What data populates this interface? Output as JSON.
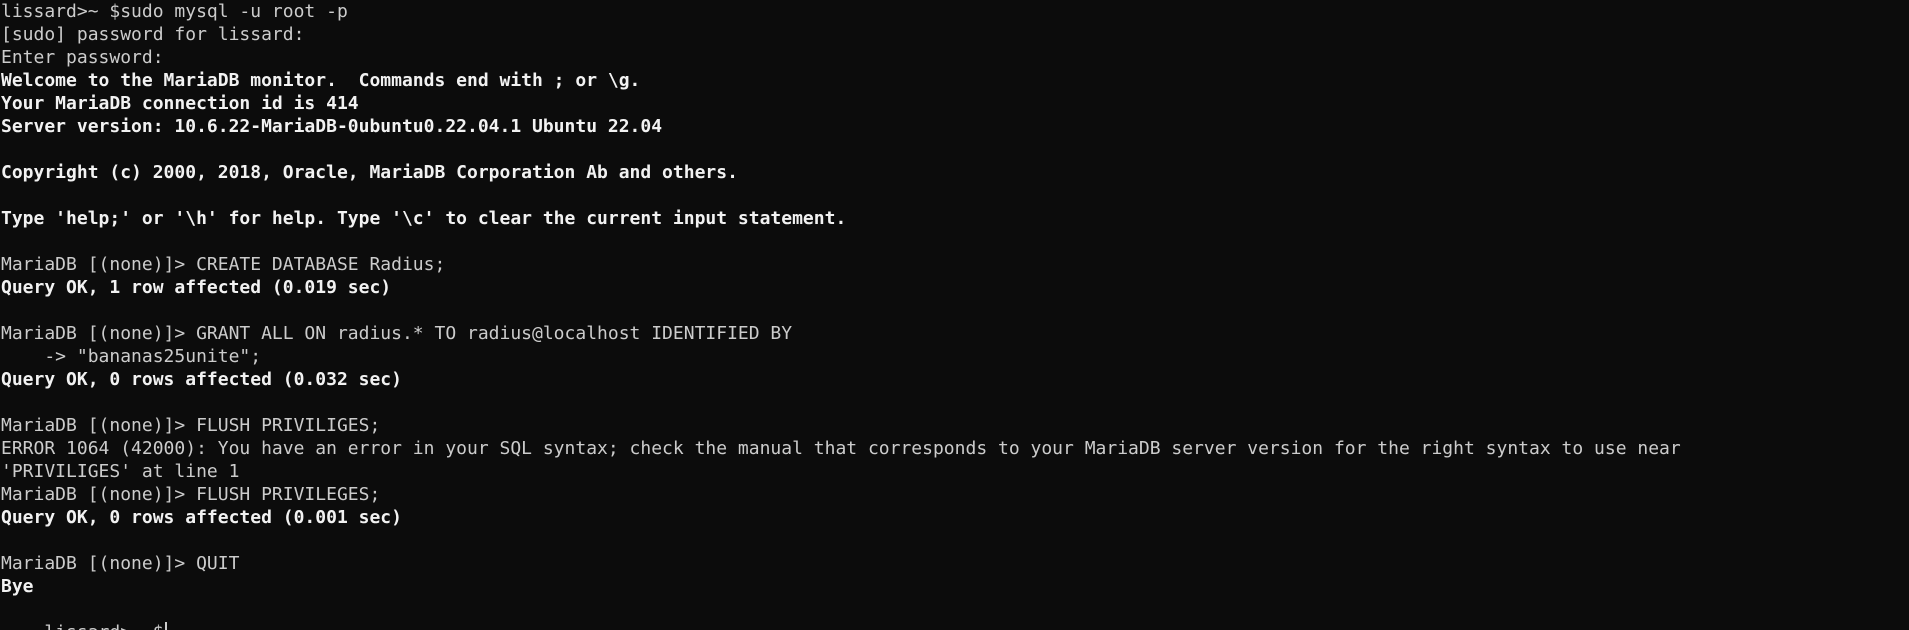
{
  "terminal": {
    "lines": [
      {
        "text": "lissard>~ $sudo mysql -u root -p",
        "style": "normal"
      },
      {
        "text": "[sudo] password for lissard:",
        "style": "normal"
      },
      {
        "text": "Enter password:",
        "style": "normal"
      },
      {
        "text": "Welcome to the MariaDB monitor.  Commands end with ; or \\g.",
        "style": "bold"
      },
      {
        "text": "Your MariaDB connection id is 414",
        "style": "bold"
      },
      {
        "text": "Server version: 10.6.22-MariaDB-0ubuntu0.22.04.1 Ubuntu 22.04",
        "style": "bold"
      },
      {
        "text": "",
        "style": "normal"
      },
      {
        "text": "Copyright (c) 2000, 2018, Oracle, MariaDB Corporation Ab and others.",
        "style": "bold"
      },
      {
        "text": "",
        "style": "normal"
      },
      {
        "text": "Type 'help;' or '\\h' for help. Type '\\c' to clear the current input statement.",
        "style": "bold"
      },
      {
        "text": "",
        "style": "normal"
      },
      {
        "text": "MariaDB [(none)]> CREATE DATABASE Radius;",
        "style": "normal"
      },
      {
        "text": "Query OK, 1 row affected (0.019 sec)",
        "style": "bold"
      },
      {
        "text": "",
        "style": "normal"
      },
      {
        "text": "MariaDB [(none)]> GRANT ALL ON radius.* TO radius@localhost IDENTIFIED BY",
        "style": "normal"
      },
      {
        "text": "    -> \"bananas25unite\";",
        "style": "normal"
      },
      {
        "text": "Query OK, 0 rows affected (0.032 sec)",
        "style": "bold"
      },
      {
        "text": "",
        "style": "normal"
      },
      {
        "text": "MariaDB [(none)]> FLUSH PRIVILIGES;",
        "style": "normal"
      },
      {
        "text": "ERROR 1064 (42000): You have an error in your SQL syntax; check the manual that corresponds to your MariaDB server version for the right syntax to use near",
        "style": "normal"
      },
      {
        "text": "'PRIVILIGES' at line 1",
        "style": "normal"
      },
      {
        "text": "MariaDB [(none)]> FLUSH PRIVILEGES;",
        "style": "normal"
      },
      {
        "text": "Query OK, 0 rows affected (0.001 sec)",
        "style": "bold"
      },
      {
        "text": "",
        "style": "normal"
      },
      {
        "text": "MariaDB [(none)]> QUIT",
        "style": "normal"
      },
      {
        "text": "Bye",
        "style": "bold"
      }
    ],
    "prompt": "lissard>~ $"
  }
}
